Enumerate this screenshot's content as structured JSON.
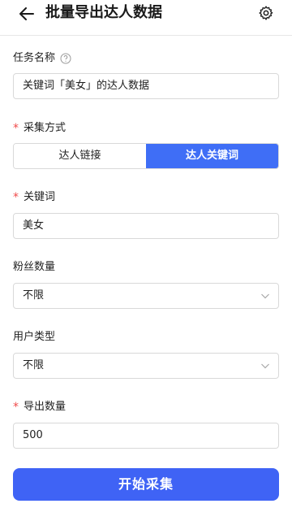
{
  "header": {
    "title": "批量导出达人数据",
    "back_icon": "arrow-left-icon",
    "settings_icon": "gear-icon"
  },
  "form": {
    "task_name": {
      "label": "任务名称",
      "help_icon": "question-circle-icon",
      "value": "关键词「美女」的达人数据"
    },
    "collect_method": {
      "label": "采集方式",
      "required_mark": "*",
      "options": [
        "达人链接",
        "达人关键词"
      ],
      "selected": "达人关键词"
    },
    "keyword": {
      "label": "关键词",
      "required_mark": "*",
      "value": "美女"
    },
    "fans_count": {
      "label": "粉丝数量",
      "value": "不限"
    },
    "user_type": {
      "label": "用户类型",
      "value": "不限"
    },
    "export_count": {
      "label": "导出数量",
      "required_mark": "*",
      "value": "500"
    }
  },
  "submit": {
    "label": "开始采集"
  },
  "colors": {
    "accent": "#3f6ef6",
    "required": "#f04b4b",
    "border": "#d9d9d9"
  }
}
